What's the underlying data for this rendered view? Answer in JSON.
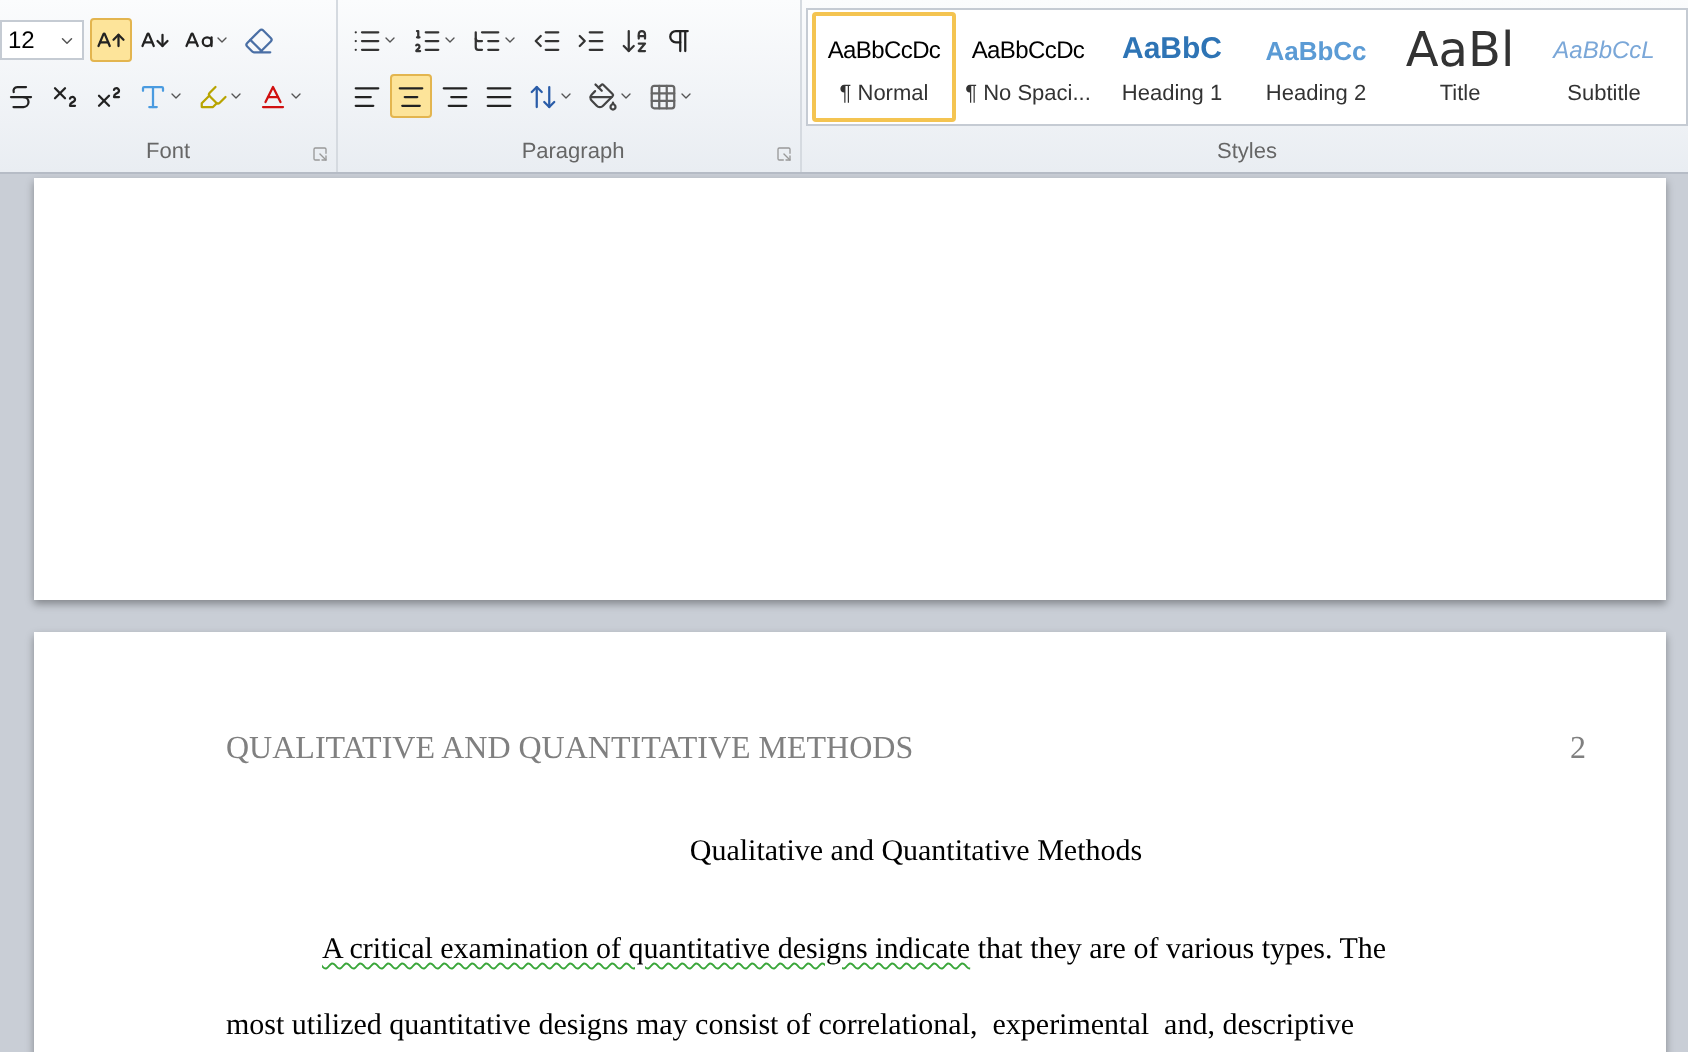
{
  "ribbon": {
    "groups": [
      {
        "kind": "font",
        "label": "Font",
        "font_size": "12",
        "rows": [
          [
            {
              "kind": "grow-font",
              "active": true
            },
            {
              "kind": "shrink-font",
              "active": false
            },
            {
              "kind": "change-case",
              "active": false
            },
            {
              "kind": "clear-formatting",
              "active": false
            }
          ],
          [
            {
              "kind": "strikethrough",
              "active": false
            },
            {
              "kind": "subscript",
              "active": false
            },
            {
              "kind": "superscript",
              "active": false
            },
            {
              "kind": "text-effects",
              "active": false
            },
            {
              "kind": "highlight",
              "active": false
            },
            {
              "kind": "font-color",
              "active": false
            }
          ]
        ]
      },
      {
        "kind": "paragraph",
        "label": "Paragraph",
        "rows": [
          [
            {
              "kind": "bullets",
              "active": false
            },
            {
              "kind": "numbering",
              "active": false
            },
            {
              "kind": "multilevel",
              "active": false
            },
            {
              "kind": "outdent",
              "active": false
            },
            {
              "kind": "indent",
              "active": false
            },
            {
              "kind": "sort",
              "active": false
            },
            {
              "kind": "pilcrow",
              "active": false
            }
          ],
          [
            {
              "kind": "align-left",
              "active": false
            },
            {
              "kind": "align-center",
              "active": true
            },
            {
              "kind": "align-right",
              "active": false
            },
            {
              "kind": "justify",
              "active": false
            },
            {
              "kind": "line-spacing",
              "active": false
            },
            {
              "kind": "shading",
              "active": false
            },
            {
              "kind": "borders",
              "active": false
            }
          ]
        ]
      },
      {
        "kind": "styles",
        "label": "Styles",
        "styles": [
          {
            "preview": "AaBbCcDc",
            "name": "¶ Normal",
            "kind": "normal",
            "selected": true
          },
          {
            "preview": "AaBbCcDc",
            "name": "¶ No Spaci...",
            "kind": "normal",
            "selected": false
          },
          {
            "preview": "AaBbC",
            "name": "Heading 1",
            "kind": "heading1",
            "selected": false
          },
          {
            "preview": "AaBbCc",
            "name": "Heading 2",
            "kind": "heading2",
            "selected": false
          },
          {
            "preview": "AaBl",
            "name": "Title",
            "kind": "title",
            "selected": false
          },
          {
            "preview": "AaBbCcL",
            "name": "Subtitle",
            "kind": "subtitle",
            "selected": false
          }
        ]
      }
    ]
  },
  "page": {
    "header": "QUALITATIVE AND QUANTITATIVE METHODS",
    "page_number": "2",
    "title": "Qualitative and Quantitative Methods",
    "paragraph": {
      "grammar_flagged": "A critical examination of quantitative designs indicate",
      "lines": [
        " that they are of various types. The",
        "most utilized quantitative designs may consist of correlational,  experimental  and, descriptive"
      ]
    }
  }
}
